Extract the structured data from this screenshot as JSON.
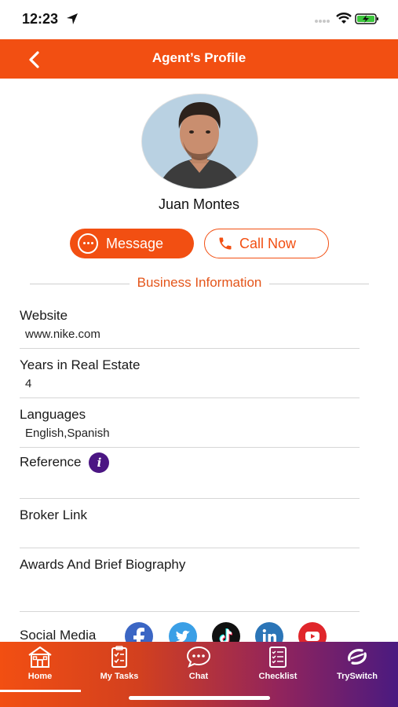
{
  "status_bar": {
    "time": "12:23"
  },
  "header": {
    "title": "Agent’s Profile"
  },
  "profile": {
    "name": "Juan Montes",
    "message_label": "Message",
    "call_label": "Call Now"
  },
  "section": {
    "title": "Business Information"
  },
  "fields": [
    {
      "label": "Website",
      "value": "www.nike.com"
    },
    {
      "label": "Years in Real Estate",
      "value": "4"
    },
    {
      "label": "Languages",
      "value": "English,Spanish"
    },
    {
      "label": "Reference",
      "value": ""
    },
    {
      "label": "Broker Link",
      "value": ""
    },
    {
      "label": "Awards And Brief Biography",
      "value": ""
    }
  ],
  "social": {
    "label": "Social Media",
    "icons": [
      "facebook-icon",
      "twitter-icon",
      "tiktok-icon",
      "linkedin-icon",
      "youtube-icon"
    ]
  },
  "tabbar": {
    "tabs": [
      {
        "label": "Home",
        "icon": "home-icon",
        "active": true
      },
      {
        "label": "My Tasks",
        "icon": "clipboard-icon",
        "active": false
      },
      {
        "label": "Chat",
        "icon": "chat-icon",
        "active": false
      },
      {
        "label": "Checklist",
        "icon": "checklist-icon",
        "active": false
      },
      {
        "label": "TrySwitch",
        "icon": "tryswitch-icon",
        "active": false
      }
    ]
  },
  "colors": {
    "brand_orange": "#f24f12",
    "section_title": "#e4551a",
    "info_purple": "#4b1683",
    "tabbar_gradient_end": "#4a1a80"
  }
}
